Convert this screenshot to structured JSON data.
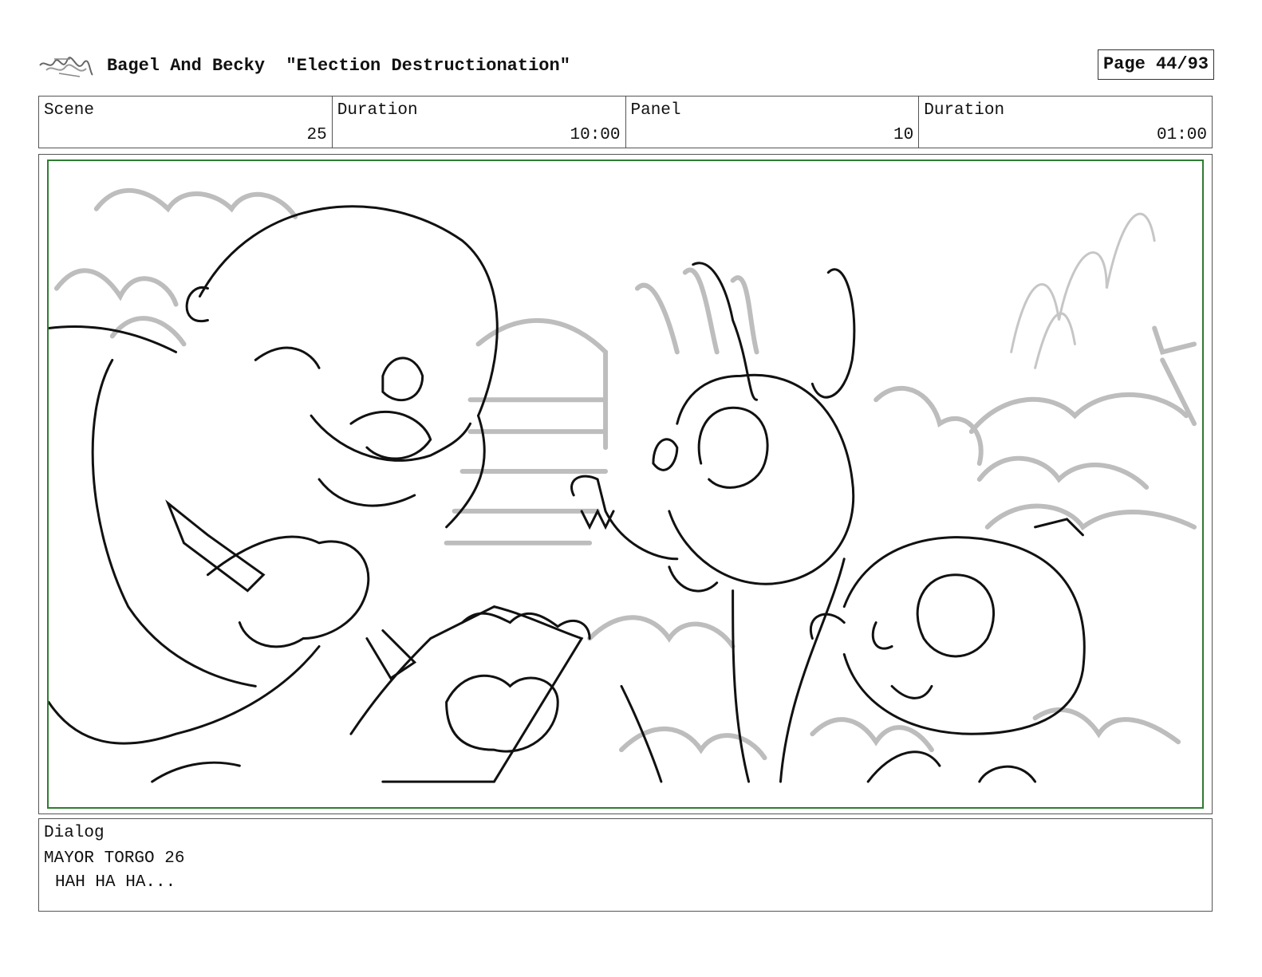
{
  "header": {
    "show_title": "Bagel And Becky  \"Election Destructionation\"",
    "page_label": "Page 44/93",
    "logo_icon": "scribble-logo-icon"
  },
  "info_bar": {
    "scene_label": "Scene",
    "scene_value": "25",
    "scene_duration_label": "Duration",
    "scene_duration_value": "10:00",
    "panel_label": "Panel",
    "panel_value": "10",
    "panel_duration_label": "Duration",
    "panel_duration_value": "01:00"
  },
  "dialog": {
    "label": "Dialog",
    "speaker": "MAYOR TORGO 26",
    "line": "HAH HA HA..."
  },
  "colors": {
    "safe_frame": "#2e7d32",
    "border": "#555555"
  }
}
